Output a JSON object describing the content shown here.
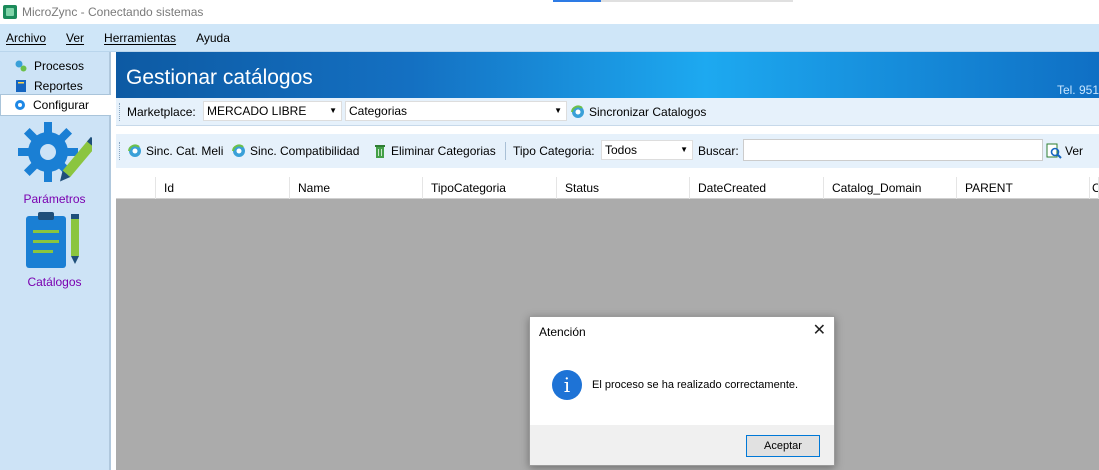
{
  "window": {
    "title": "MicroZync - Conectando sistemas"
  },
  "menu": [
    {
      "label": "Archivo"
    },
    {
      "label": "Ver"
    },
    {
      "label": "Herramientas"
    },
    {
      "label": "Ayuda"
    }
  ],
  "nav": {
    "tabs": [
      {
        "label": "Procesos"
      },
      {
        "label": "Reportes"
      },
      {
        "label": "Configurar"
      }
    ],
    "items": [
      {
        "label": "Parámetros",
        "icon": "gear-pencil-icon"
      },
      {
        "label": "Catálogos",
        "icon": "clipboard-pencil-icon"
      }
    ]
  },
  "header": {
    "title": "Gestionar catálogos",
    "tel": "Tel. 951"
  },
  "toolbar1": {
    "marketplace_label": "Marketplace:",
    "marketplace_value": "MERCADO LIBRE",
    "type_value": "Categorias",
    "sync_button": "Sincronizar Catalogos"
  },
  "toolbar2": {
    "sinc_meli": "Sinc. Cat. Meli",
    "sinc_compat": "Sinc. Compatibilidad",
    "eliminar": "Eliminar Categorias",
    "tipo_label": "Tipo Categoria:",
    "tipo_value": "Todos",
    "buscar_label": "Buscar:",
    "buscar_value": "",
    "ver_button": "Ver"
  },
  "grid": {
    "columns": [
      "",
      "Id",
      "Name",
      "TipoCategoria",
      "Status",
      "DateCreated",
      "Catalog_Domain",
      "PARENT",
      "C"
    ]
  },
  "dialog": {
    "title": "Atención",
    "message": "El proceso se ha realizado correctamente.",
    "ok_button": "Aceptar"
  },
  "colors": {
    "header_blue": "#1470c2",
    "nav_purple": "#7a00b0",
    "nav_bg": "#cde3f6"
  }
}
